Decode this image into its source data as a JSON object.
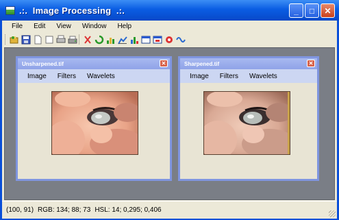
{
  "window": {
    "title": ".:.  Image Processing  .:.",
    "buttons": {
      "minimize": "_",
      "maximize": "□",
      "close": "✕"
    }
  },
  "menu": [
    "File",
    "Edit",
    "View",
    "Window",
    "Help"
  ],
  "toolbar_icons": [
    "open-icon",
    "save-icon",
    "new-icon",
    "blank-icon",
    "print-icon",
    "scan-icon",
    "cut-icon",
    "refresh-icon",
    "histogram-icon",
    "histogram2-icon",
    "histogram3-icon",
    "window-icon",
    "window2-icon",
    "color-icon",
    "wavelet-icon"
  ],
  "children": [
    {
      "title": "Unsharpened.tif",
      "menu": [
        "Image",
        "Filters",
        "Wavelets"
      ],
      "close": "✕"
    },
    {
      "title": "Sharpened.tif",
      "menu": [
        "Image",
        "Filters",
        "Wavelets"
      ],
      "close": "✕"
    }
  ],
  "status": {
    "coords": "(100, 91)",
    "rgb": "RGB: 134; 88; 73",
    "hsl": "HSL: 14; 0,295; 0,406"
  },
  "colors": {
    "titlebar": "#0a5de3",
    "mdi_background": "#7a7e86",
    "child_border": "#7f95e0",
    "child_menu": "#ccd6f2"
  }
}
